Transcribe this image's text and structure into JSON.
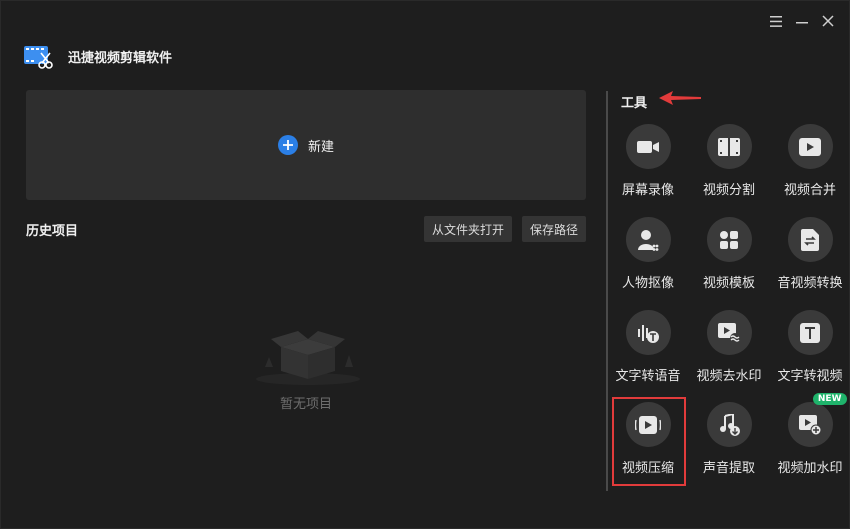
{
  "app": {
    "title": "迅捷视频剪辑软件",
    "icon": "film-scissors-logo"
  },
  "window_controls": {
    "menu_icon": "hamburger-menu-icon",
    "minimize_icon": "minimize-icon",
    "close_icon": "close-icon"
  },
  "create": {
    "label": "新建",
    "icon": "plus-circle-icon",
    "accent": "#2b7fe6"
  },
  "history": {
    "title": "历史项目",
    "open_folder_label": "从文件夹打开",
    "save_path_label": "保存路径",
    "empty_label": "暂无项目"
  },
  "tools": {
    "title": "工具",
    "items": [
      {
        "label": "屏幕录像",
        "icon": "camera-icon"
      },
      {
        "label": "视频分割",
        "icon": "film-split-icon"
      },
      {
        "label": "视频合并",
        "icon": "video-merge-icon"
      },
      {
        "label": "人物抠像",
        "icon": "person-cutout-icon"
      },
      {
        "label": "视频模板",
        "icon": "template-icon"
      },
      {
        "label": "音视频转换",
        "icon": "convert-icon"
      },
      {
        "label": "文字转语音",
        "icon": "text-to-speech-icon"
      },
      {
        "label": "视频去水印",
        "icon": "remove-watermark-icon"
      },
      {
        "label": "文字转视频",
        "icon": "text-to-video-icon"
      },
      {
        "label": "视频压缩",
        "icon": "video-compress-icon"
      },
      {
        "label": "声音提取",
        "icon": "audio-extract-icon"
      },
      {
        "label": "视频加水印",
        "icon": "add-watermark-icon",
        "badge": "NEW"
      }
    ],
    "highlight_color": "#e23b3b",
    "badge_color": "#1fb36b"
  }
}
